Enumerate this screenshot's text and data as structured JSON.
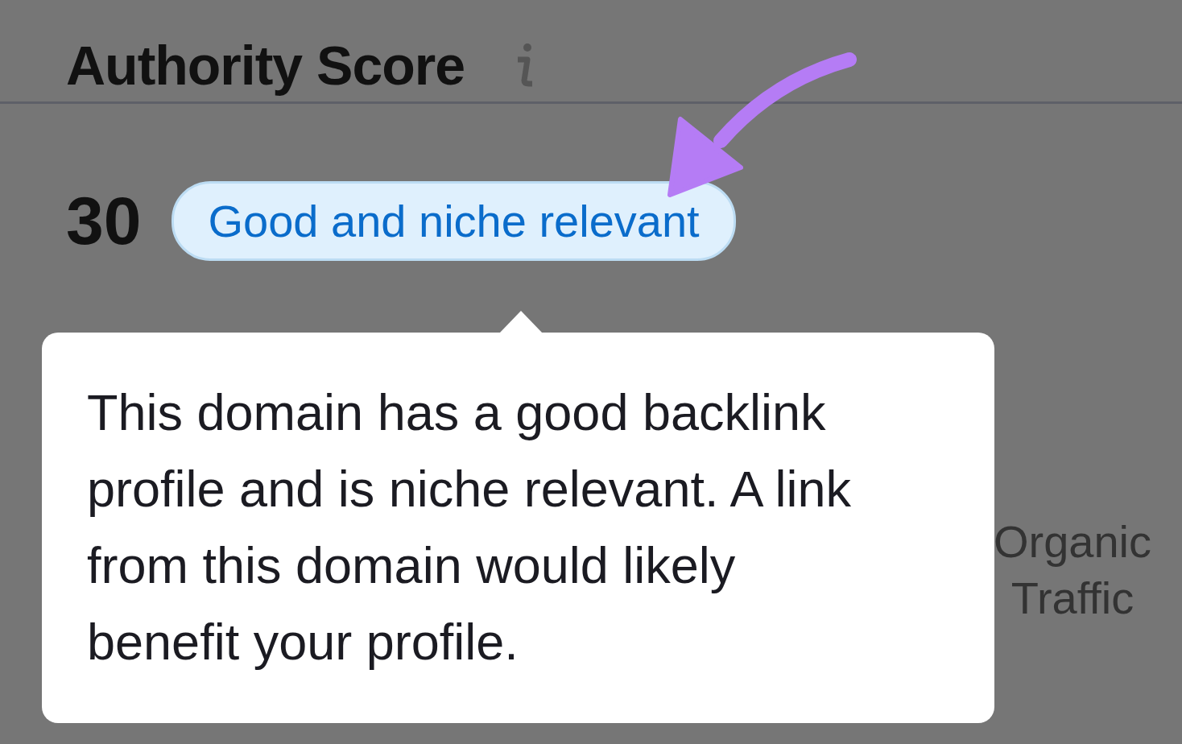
{
  "header": {
    "title": "Authority Score"
  },
  "score": {
    "value": "30",
    "badge": "Good and niche relevant"
  },
  "tooltip": {
    "text": "This domain has a good backlink profile and is niche relevant. A link from this domain would likely benefit your profile."
  },
  "background_metric": {
    "label": "Organic Traffic"
  }
}
